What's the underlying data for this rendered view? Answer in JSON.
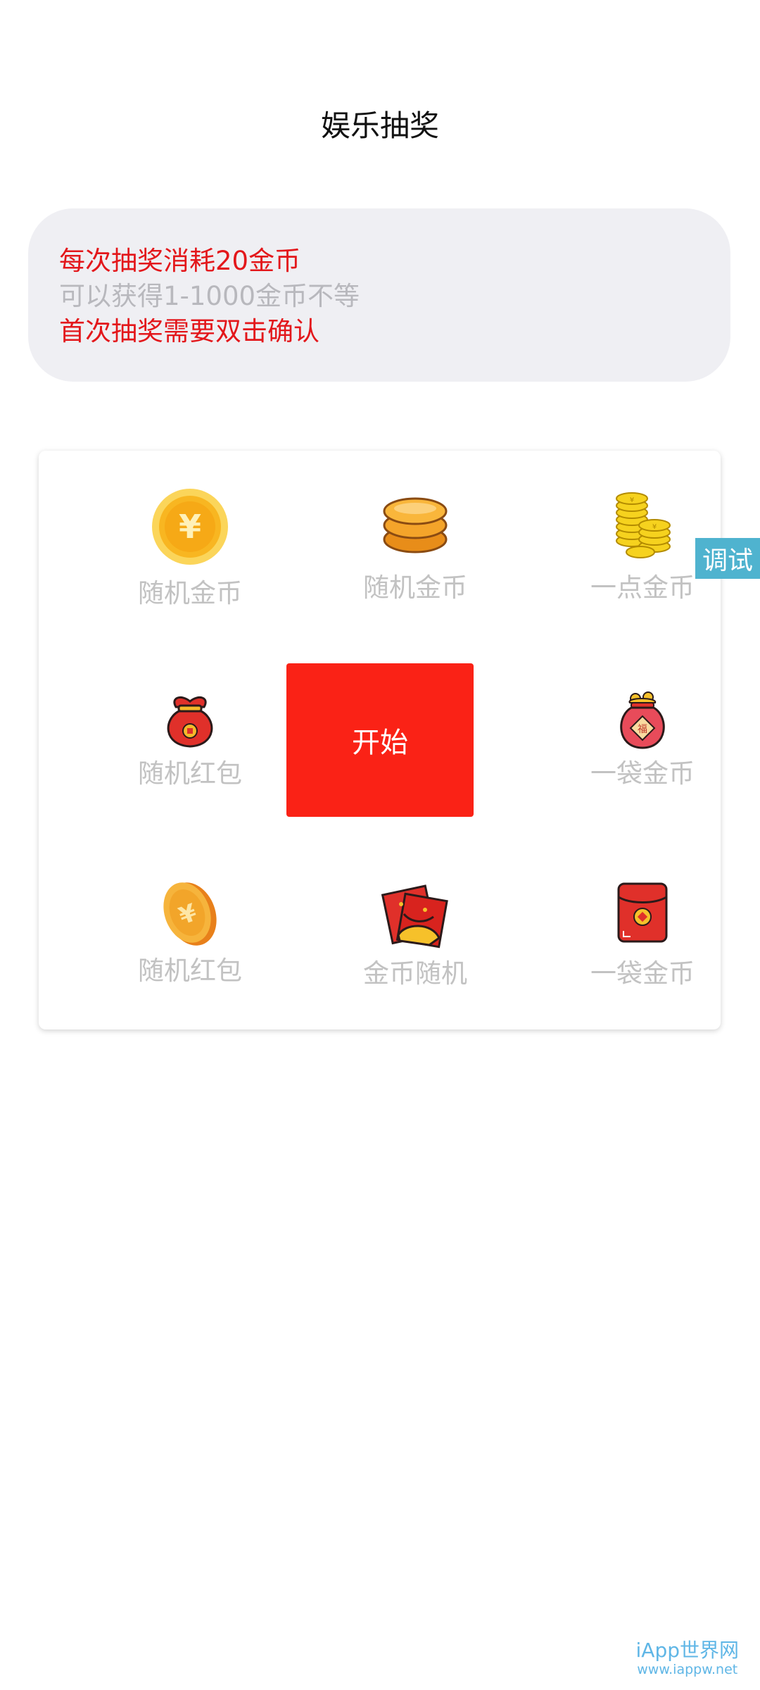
{
  "header": {
    "title": "娱乐抽奖"
  },
  "info": {
    "line1": "每次抽奖消耗20金币",
    "line2": "可以获得1-1000金币不等",
    "line3": "首次抽奖需要双击确认",
    "line1_color": "#e3171b",
    "line2_color": "#b8b8bd",
    "line3_color": "#e3171b"
  },
  "prizes": [
    {
      "label": "随机金币",
      "icon": "yuan-coin-icon"
    },
    {
      "label": "随机金币",
      "icon": "coin-stack-icon"
    },
    {
      "label": "一点金币",
      "icon": "coin-piles-icon"
    },
    {
      "label": "一袋金币",
      "icon": "money-bag-icon"
    },
    {
      "label": "一袋金币",
      "icon": "fu-bag-icon"
    },
    {
      "label": "金币随机",
      "icon": "tilted-coin-icon"
    },
    {
      "label": "随机红包",
      "icon": "open-red-envelope-icon"
    },
    {
      "label": "随机红包",
      "icon": "red-envelope-icon"
    }
  ],
  "start_button": {
    "label": "开始",
    "color": "#fa2216"
  },
  "debug_tab": {
    "label": "调试",
    "color": "#4fb3cf"
  },
  "watermark": {
    "line1": "iApp世界网",
    "line2": "www.iappw.net"
  }
}
